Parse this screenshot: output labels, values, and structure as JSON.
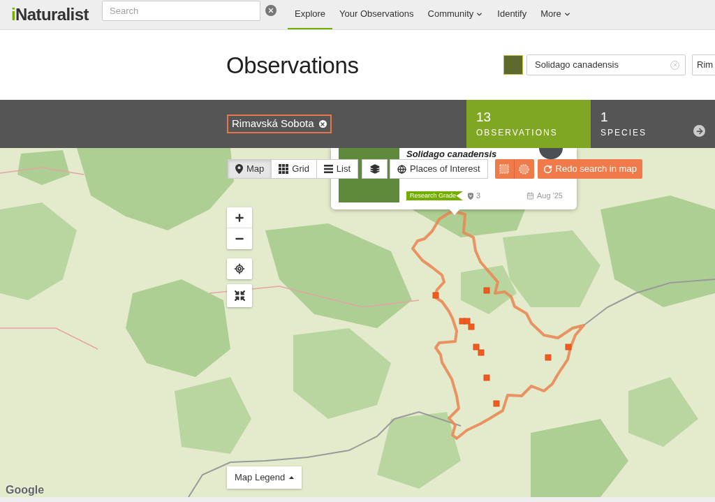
{
  "header": {
    "logo": "iNaturalist",
    "search": {
      "placeholder": "Search"
    },
    "nav": [
      {
        "label": "Explore",
        "selected": true,
        "dropdown": false
      },
      {
        "label": "Your Observations",
        "selected": false,
        "dropdown": false
      },
      {
        "label": "Community",
        "selected": false,
        "dropdown": true
      },
      {
        "label": "Identify",
        "selected": false,
        "dropdown": false
      },
      {
        "label": "More",
        "selected": false,
        "dropdown": true
      }
    ]
  },
  "page": {
    "title": "Observations",
    "filters": [
      {
        "kind": "taxon",
        "value": "Solidago canadensis"
      },
      {
        "kind": "place",
        "value": "Rim"
      }
    ]
  },
  "stats_bar": {
    "place_chip": "Rimavská Sobota",
    "stats": [
      {
        "count": "13",
        "label": "OBSERVATIONS",
        "selected": true
      },
      {
        "count": "1",
        "label": "SPECIES",
        "selected": false
      }
    ]
  },
  "map": {
    "view_tabs": [
      {
        "label": "Map",
        "selected": true
      },
      {
        "label": "Grid",
        "selected": false
      },
      {
        "label": "List",
        "selected": false
      }
    ],
    "places_button": "Places of Interest",
    "redo_button": "Redo search in map",
    "popup": {
      "title": "Solidago canadensis",
      "quality": "Research Grade",
      "identifications": "3",
      "date": "Aug '25"
    },
    "legend_button": "Map Legend",
    "attribution": "Google"
  }
}
